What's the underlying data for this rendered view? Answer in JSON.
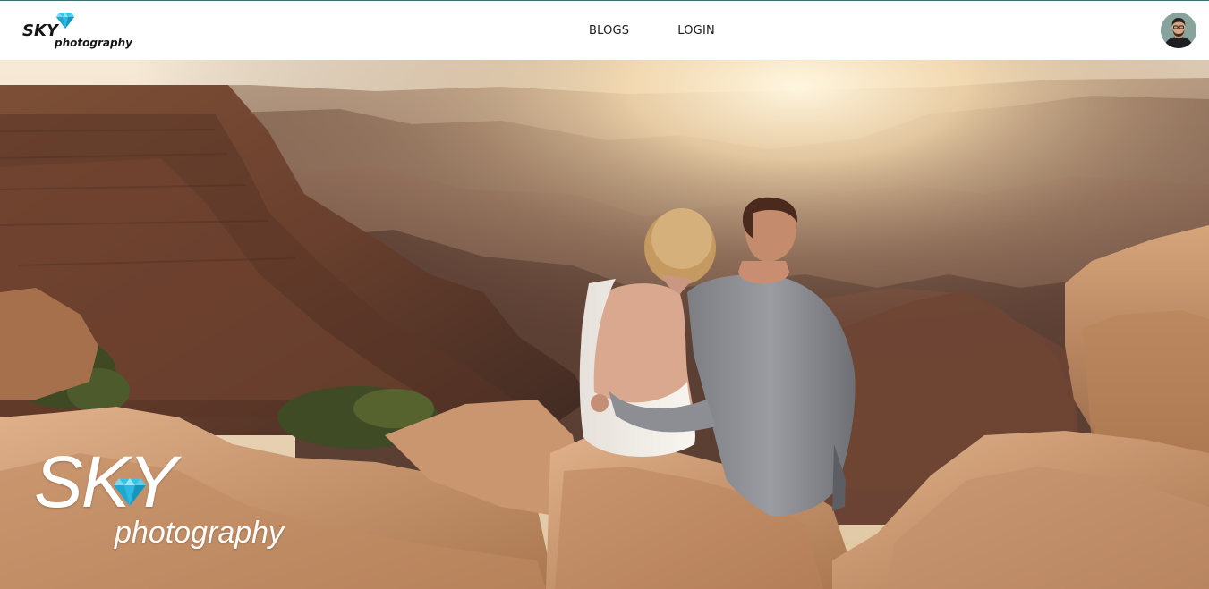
{
  "navbar": {
    "brand": {
      "title": "SKY",
      "subtitle": "photography",
      "icon": "diamond-icon"
    },
    "links": [
      {
        "label": "BLOGS"
      },
      {
        "label": "LOGIN"
      }
    ],
    "avatar": {
      "icon": "user-avatar"
    }
  },
  "hero": {
    "image": "couple-at-canyon-sunset",
    "logo": {
      "title": "SKY",
      "subtitle": "photography",
      "icon": "diamond-icon"
    }
  },
  "colors": {
    "accent": "#35c3e6",
    "nav_text": "#1b1b1b",
    "top_border": "#3f6c6c"
  }
}
